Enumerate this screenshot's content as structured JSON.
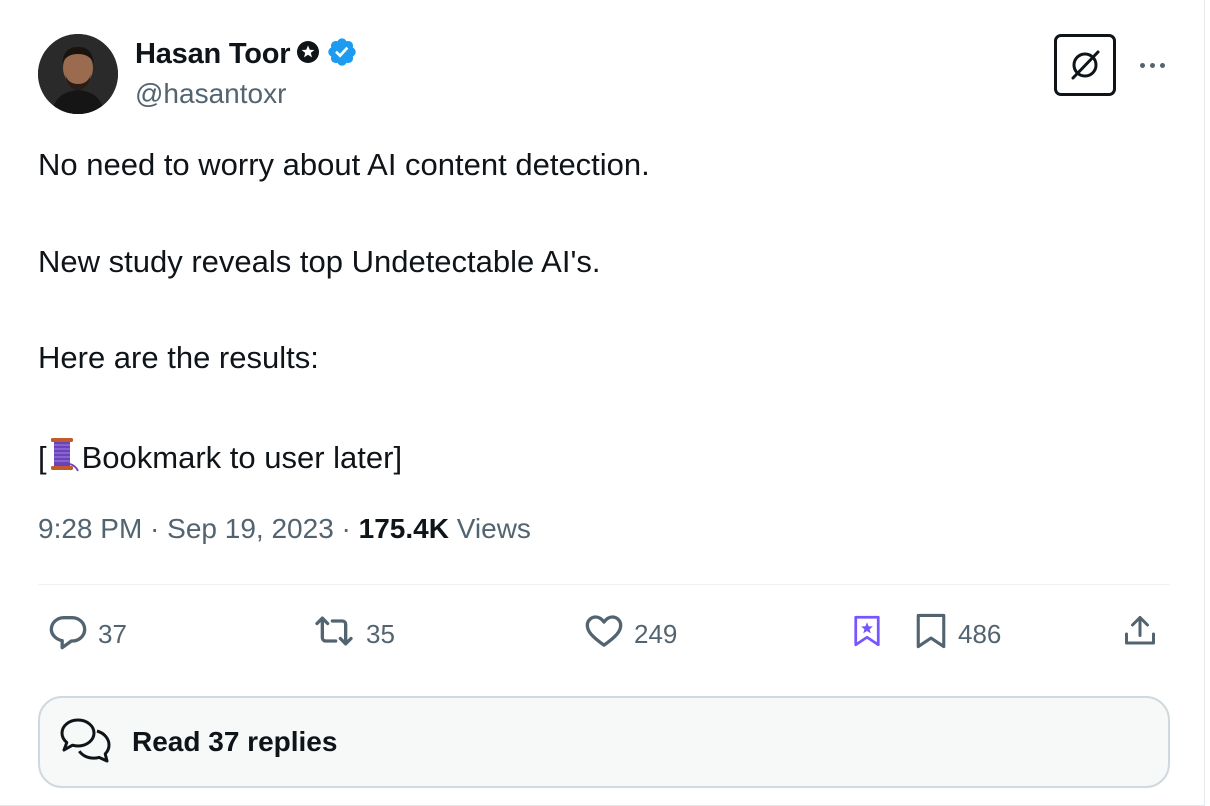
{
  "author": {
    "display_name": "Hasan Toor",
    "handle": "@hasantoxr"
  },
  "tweet": {
    "lines": [
      "No need to worry about AI content detection.",
      "New study reveals top Undetectable AI's.",
      "Here are the results:"
    ],
    "last_line_prefix": "[",
    "last_line_icon": "thread-spool-icon",
    "last_line_text": "Bookmark to user later]"
  },
  "meta": {
    "time": "9:28 PM",
    "separator": " · ",
    "date": "Sep 19, 2023",
    "views_count": "175.4K",
    "views_label": "Views"
  },
  "actions": {
    "replies": "37",
    "retweets": "35",
    "likes": "249",
    "bookmarks": "486"
  },
  "read_replies_label": "Read 37 replies",
  "colors": {
    "text_primary": "#0f1419",
    "text_secondary": "#536471",
    "verified_blue": "#1d9bf0",
    "grok_purple": "#7856ff",
    "border": "#cfd9de"
  },
  "icons": {
    "affiliate_badge": "gear-badge-icon",
    "verified": "verified-badge-icon",
    "logo": "grok-logo-icon",
    "more": "more-dots-icon",
    "reply": "reply-bubble-icon",
    "retweet": "retweet-icon",
    "like": "heart-icon",
    "grok": "grok-bookmark-icon",
    "bookmark": "bookmark-icon",
    "share": "share-icon",
    "replies": "conversation-bubbles-icon"
  }
}
